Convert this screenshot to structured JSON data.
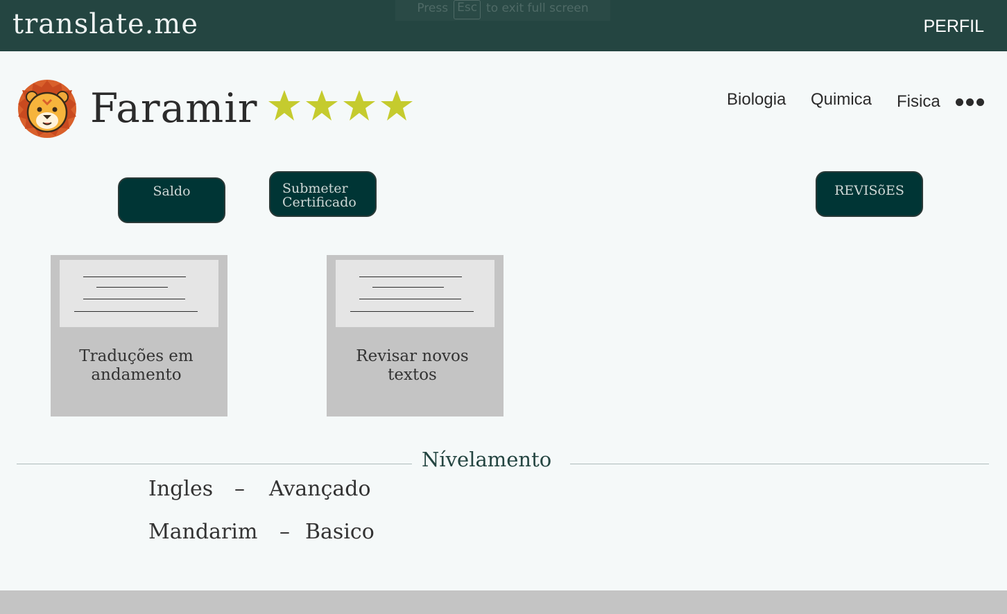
{
  "header": {
    "brand": "translate.me",
    "profile_link": "PERFIL",
    "fullscreen_hint": {
      "prefix": "Press",
      "key": "Esc",
      "suffix": "to exit full screen"
    }
  },
  "profile": {
    "name": "Faramir",
    "rating": 4,
    "avatar": "lion-avatar-icon",
    "star_color": "#c5cb2e"
  },
  "subjects": [
    "Biologia",
    "Quimica",
    "Fisica"
  ],
  "more_icon": "more-dots-icon",
  "buttons": {
    "saldo": "Saldo",
    "submeter_line1": "Submeter",
    "submeter_line2": "Certificado",
    "revisoes": "REVISõES"
  },
  "cards": [
    {
      "label_line1": "Traduções em",
      "label_line2": "andamento"
    },
    {
      "label_line1": "Revisar novos",
      "label_line2": "textos"
    }
  ],
  "leveling": {
    "title": "Nívelamento",
    "items": [
      {
        "language": "Ingles",
        "separator": "–",
        "level": "Avançado"
      },
      {
        "language": "Mandarim",
        "separator": "–",
        "level": "Basico"
      }
    ]
  },
  "colors": {
    "topbar": "#244541",
    "button": "#003535",
    "card": "#c4c4c4",
    "background": "#f5f9f9"
  }
}
